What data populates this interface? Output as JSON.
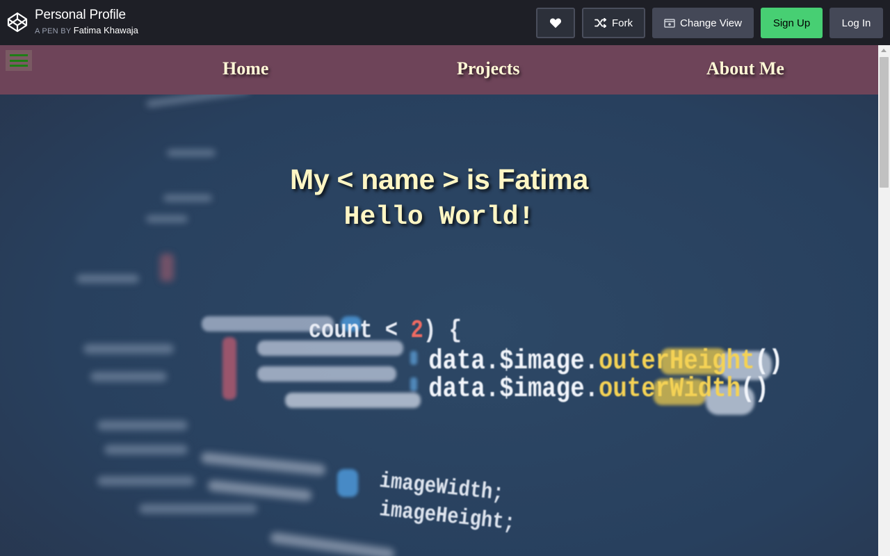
{
  "header": {
    "title": "Personal Profile",
    "by_prefix": "A PEN BY",
    "author": "Fatima Khawaja"
  },
  "toolbar": {
    "heart_icon": "heart-icon",
    "fork_label": "Fork",
    "fork_icon": "fork-icon",
    "change_view_label": "Change View",
    "change_view_icon": "view-icon",
    "signup_label": "Sign Up",
    "login_label": "Log In"
  },
  "colors": {
    "topbar": "#1e1f26",
    "signup": "#47cf73",
    "navbar": "#6e4459",
    "hero_text": "#fff6c4"
  },
  "preview": {
    "nav": {
      "menu_icon": "hamburger-icon",
      "items": [
        "Home",
        "Projects",
        "About Me"
      ]
    },
    "hero": {
      "title": "My < name > is Fatima",
      "subtitle": "Hello World!",
      "background": {
        "line1_a": "count < ",
        "line1_b": "2",
        "line1_c": ") {",
        "line2_a": "data.$image.",
        "line2_b": "outerHeight",
        "line2_c": "()",
        "line3_a": "data.$image.",
        "line3_b": "outerWidth",
        "line3_c": "()",
        "line4": "imageWidth;",
        "line5": "imageHeight;"
      }
    }
  }
}
